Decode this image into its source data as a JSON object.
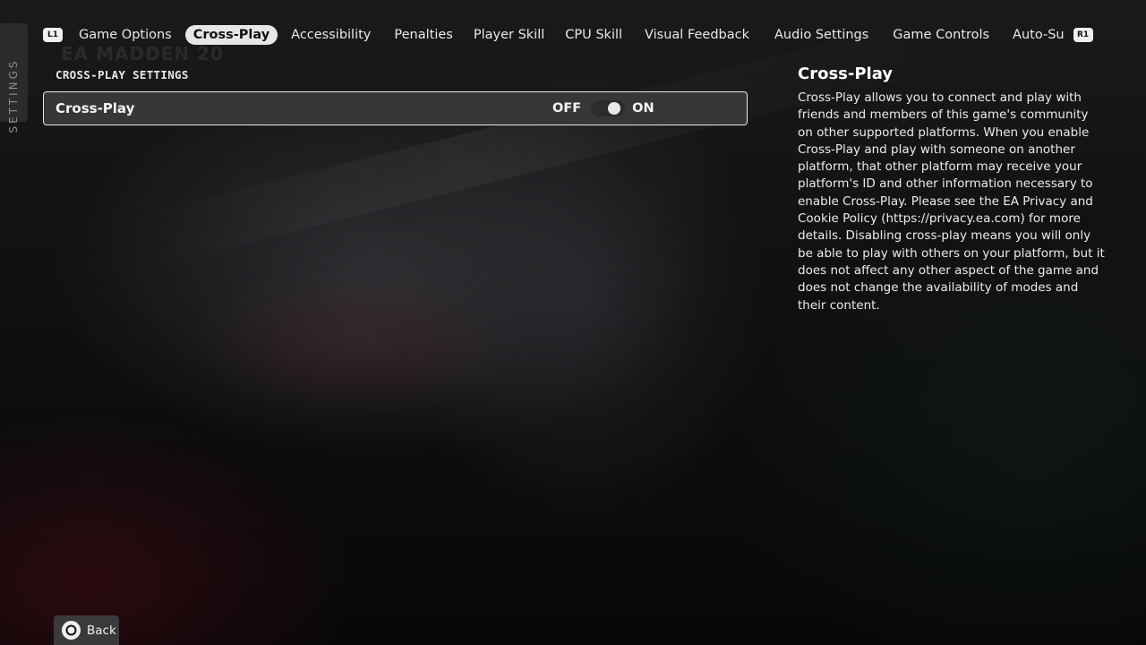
{
  "background": {
    "watermark_text": "EA MADDEN 20"
  },
  "side_tab": {
    "label": "SETTINGS"
  },
  "tabs": {
    "left_button": "L1",
    "right_button": "R1",
    "items": [
      {
        "label": "Game Options",
        "active": false
      },
      {
        "label": "Cross-Play",
        "active": true
      },
      {
        "label": "Accessibility",
        "active": false
      },
      {
        "label": "Penalties",
        "active": false
      },
      {
        "label": "Player Skill",
        "active": false
      },
      {
        "label": "CPU Skill",
        "active": false
      },
      {
        "label": "Visual Feedback",
        "active": false
      },
      {
        "label": "Audio Settings",
        "active": false
      },
      {
        "label": "Game Controls",
        "active": false
      },
      {
        "label": "Auto-Su",
        "active": false
      }
    ]
  },
  "section": {
    "title": "CROSS-PLAY SETTINGS"
  },
  "setting": {
    "label": "Cross-Play",
    "off_label": "OFF",
    "on_label": "ON",
    "state": "on"
  },
  "description": {
    "title": "Cross-Play",
    "body": "Cross-Play allows you to connect and play with friends and members of this game's community on other supported platforms. When you enable Cross-Play and play with someone on another platform, that other platform may receive your platform's ID and other information necessary to enable Cross-Play. Please see the EA Privacy and Cookie Policy (https://privacy.ea.com) for more details. Disabling cross-play means you will only be able to play with others on your platform, but it does not affect any other aspect of the game and does not change the availability of modes and their content."
  },
  "footer": {
    "back_label": "Back",
    "back_icon": "circle-button-icon"
  },
  "colors": {
    "active_tab_bg": "#e6e6e6",
    "row_bg": "#373739",
    "row_border": "#e8e8e8"
  }
}
